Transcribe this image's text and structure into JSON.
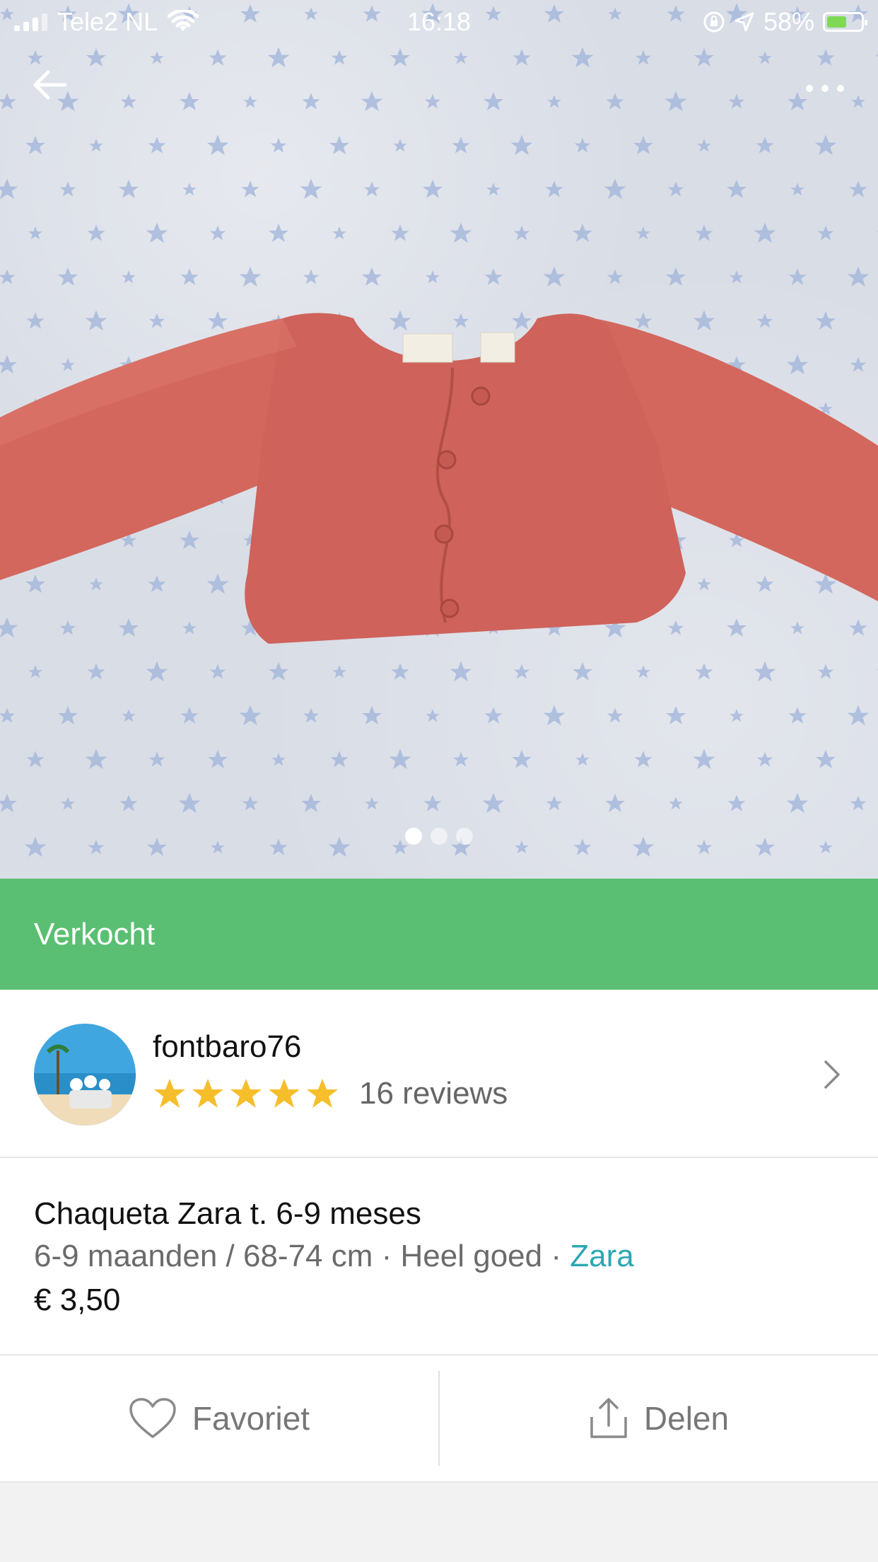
{
  "status_bar": {
    "carrier": "Tele2 NL",
    "time": "16:18",
    "battery_percent": "58%",
    "battery_level": 0.58,
    "icons": [
      "signal-icon",
      "wifi-icon",
      "orientation-lock-icon",
      "location-arrow-icon",
      "battery-charging-icon"
    ]
  },
  "nav": {
    "back_icon": "arrow-left-icon",
    "more_icon": "more-dots-icon"
  },
  "gallery": {
    "image_count": 3,
    "active_index": 0
  },
  "status_banner": {
    "label": "Verkocht",
    "color": "#5abf72"
  },
  "seller": {
    "username": "fontbaro76",
    "rating_stars": 5,
    "reviews_label": "16 reviews"
  },
  "item": {
    "title": "Chaqueta Zara t. 6-9 meses",
    "size": "6-9 maanden / 68-74 cm",
    "separator": "·",
    "condition": "Heel goed",
    "brand": "Zara",
    "price": "€ 3,50",
    "brand_color": "#2ba7b3"
  },
  "actions": {
    "favorite_label": "Favoriet",
    "share_label": "Delen"
  }
}
